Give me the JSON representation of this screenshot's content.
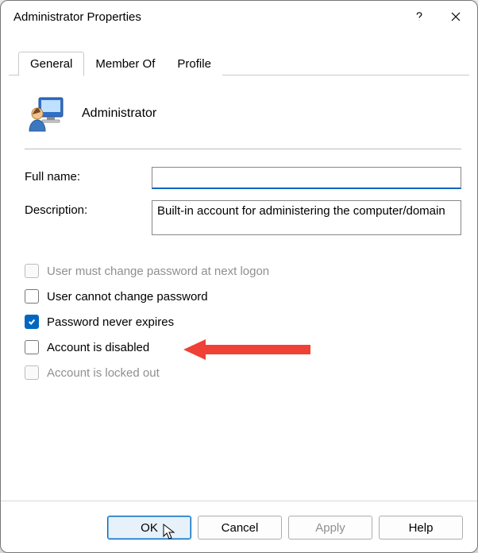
{
  "window": {
    "title": "Administrator Properties"
  },
  "tabs": [
    {
      "label": "General"
    },
    {
      "label": "Member Of"
    },
    {
      "label": "Profile"
    }
  ],
  "identity": {
    "name": "Administrator"
  },
  "form": {
    "full_name_label": "Full name:",
    "full_name_value": "",
    "description_label": "Description:",
    "description_value": "Built-in account for administering the computer/domain"
  },
  "checks": {
    "must_change": {
      "label": "User must change password at next logon",
      "checked": false,
      "enabled": false
    },
    "cannot_change": {
      "label": "User cannot change password",
      "checked": false,
      "enabled": true
    },
    "never_expires": {
      "label": "Password never expires",
      "checked": true,
      "enabled": true
    },
    "disabled": {
      "label": "Account is disabled",
      "checked": false,
      "enabled": true
    },
    "locked_out": {
      "label": "Account is locked out",
      "checked": false,
      "enabled": false
    }
  },
  "buttons": {
    "ok": "OK",
    "cancel": "Cancel",
    "apply": "Apply",
    "help": "Help"
  },
  "annotation": {
    "arrow_target": "account-disabled-checkbox",
    "arrow_color": "#ef4136"
  }
}
